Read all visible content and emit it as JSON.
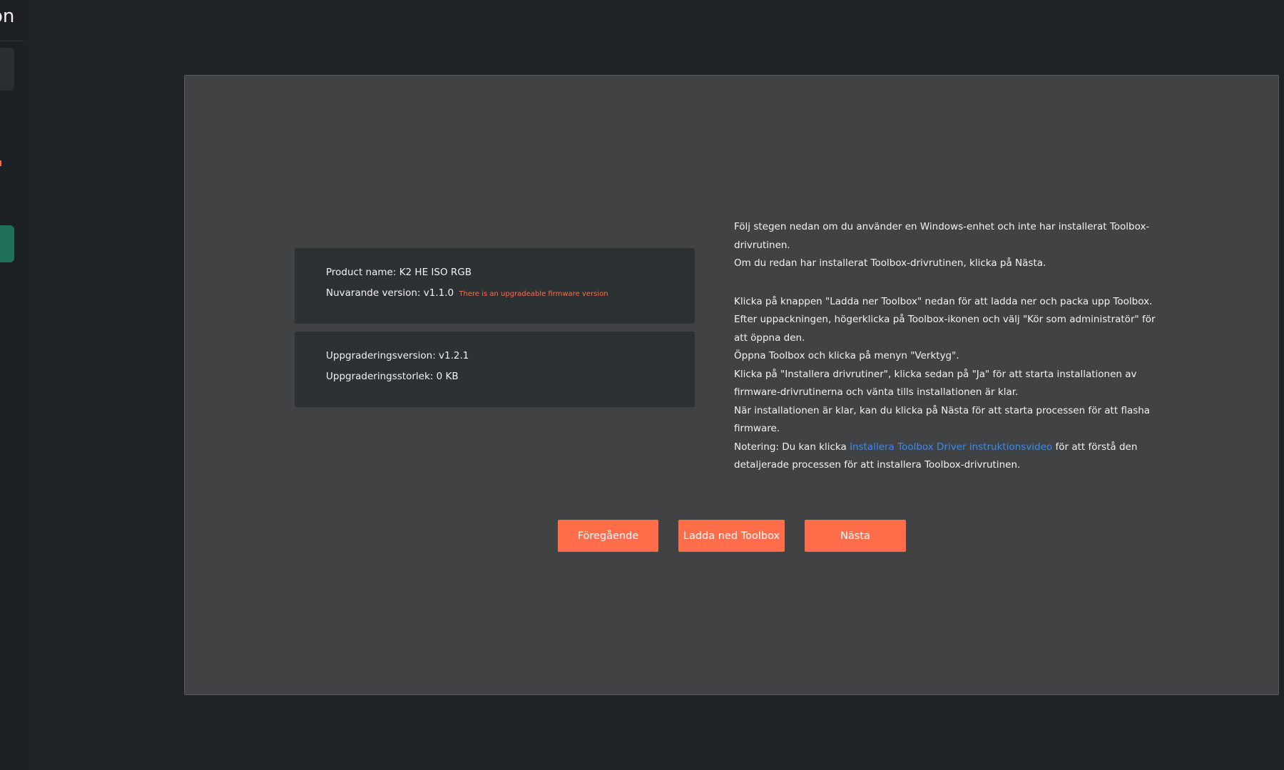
{
  "sidebar": {
    "title_fragment": "on"
  },
  "device": {
    "product_label": "Product name:",
    "product_name": "K2 HE ISO RGB",
    "current_version_label": "Nuvarande version:",
    "current_version": "v1.1.0",
    "upgrade_notice": "There is an upgradeable firmware version",
    "upgrade_version_label": "Uppgraderingsversion:",
    "upgrade_version": "v1.2.1",
    "upgrade_size_label": "Uppgraderingsstorlek:",
    "upgrade_size": "0 KB"
  },
  "instructions": {
    "intro_1": "Följ stegen nedan om du använder en Windows-enhet och inte har installerat Toolbox-drivrutinen.",
    "intro_2": "Om du redan har installerat Toolbox-drivrutinen, klicka på Nästa.",
    "step_1": "Klicka på knappen \"Ladda ner Toolbox\" nedan för att ladda ner och packa upp Toolbox.",
    "step_2": "Efter uppackningen, högerklicka på Toolbox-ikonen och välj \"Kör som administratör\" för att öppna den.",
    "step_3": "Öppna Toolbox och klicka på menyn \"Verktyg\".",
    "step_4": "Klicka på \"Installera drivrutiner\", klicka sedan på \"Ja\" för att starta installationen av firmware-drivrutinerna och vänta tills installationen är klar.",
    "step_5": "När installationen är klar, kan du klicka på Nästa för att starta processen för att flasha firmware.",
    "note_prefix": "Notering: Du kan klicka ",
    "note_link": "Installera Toolbox Driver instruktionsvideo",
    "note_suffix": " för att förstå den detaljerade processen för att installera Toolbox-drivrutinen."
  },
  "buttons": {
    "previous": "Föregående",
    "download": "Ladda ned Toolbox",
    "next": "Nästa"
  },
  "colors": {
    "accent": "#ff6d4a",
    "link": "#3b8be8",
    "panel": "#414243",
    "card": "#2c3133"
  }
}
